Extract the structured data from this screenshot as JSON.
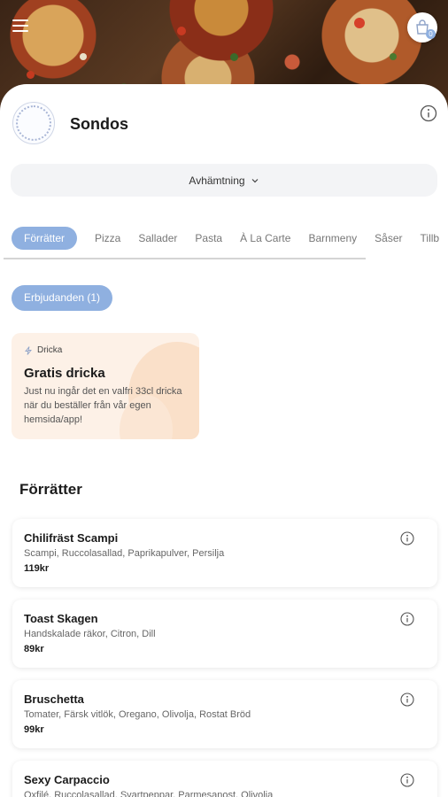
{
  "restaurant": {
    "name": "Sondos"
  },
  "order_mode": {
    "label": "Avhämtning"
  },
  "categories": [
    "Förrätter",
    "Pizza",
    "Sallader",
    "Pasta",
    "À La Carte",
    "Barnmeny",
    "Såser",
    "Tillb"
  ],
  "offers": {
    "label": "Erbjudanden (1)"
  },
  "promo": {
    "tag": "Dricka",
    "title": "Gratis dricka",
    "description": "Just nu ingår det en valfri 33cl dricka när du beställer från vår egen hemsida/app!"
  },
  "section": {
    "title": "Förrätter"
  },
  "cart": {
    "count": "0"
  },
  "menu_items": [
    {
      "name": "Chilifräst Scampi",
      "description": "Scampi, Ruccolasallad, Paprikapulver, Persilja",
      "price": "119kr"
    },
    {
      "name": "Toast Skagen",
      "description": "Handskalade räkor, Citron, Dill",
      "price": "89kr"
    },
    {
      "name": "Bruschetta",
      "description": "Tomater, Färsk vitlök, Oregano, Olivolja, Rostat Bröd",
      "price": "99kr"
    },
    {
      "name": "Sexy Carpaccio",
      "description": "Oxfilé, Ruccolasallad, Svartpeppar, Parmesanost, Olivolja",
      "price": ""
    }
  ],
  "colors": {
    "accent": "#8fb0e0",
    "promo_bg": "#fdf1e7"
  },
  "icons": {
    "menu": "hamburger-icon",
    "cart": "shopping-bag-icon",
    "info": "info-icon",
    "chevron": "chevron-down-icon",
    "promo": "lightning-icon"
  }
}
